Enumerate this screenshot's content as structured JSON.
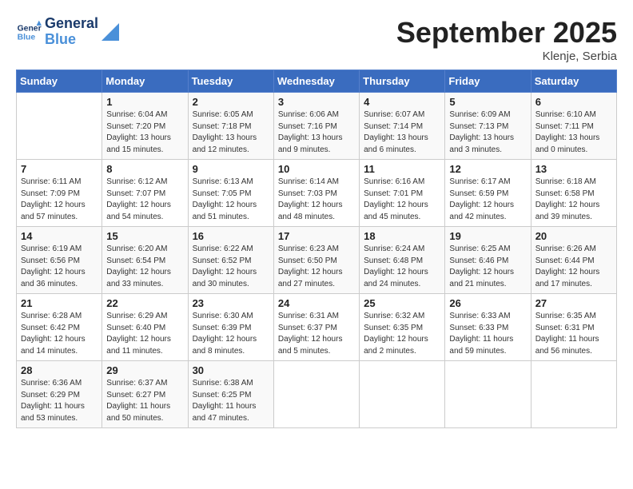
{
  "header": {
    "logo_general": "General",
    "logo_blue": "Blue",
    "month_title": "September 2025",
    "location": "Klenje, Serbia"
  },
  "weekdays": [
    "Sunday",
    "Monday",
    "Tuesday",
    "Wednesday",
    "Thursday",
    "Friday",
    "Saturday"
  ],
  "weeks": [
    [
      {
        "day": "",
        "info": ""
      },
      {
        "day": "1",
        "info": "Sunrise: 6:04 AM\nSunset: 7:20 PM\nDaylight: 13 hours\nand 15 minutes."
      },
      {
        "day": "2",
        "info": "Sunrise: 6:05 AM\nSunset: 7:18 PM\nDaylight: 13 hours\nand 12 minutes."
      },
      {
        "day": "3",
        "info": "Sunrise: 6:06 AM\nSunset: 7:16 PM\nDaylight: 13 hours\nand 9 minutes."
      },
      {
        "day": "4",
        "info": "Sunrise: 6:07 AM\nSunset: 7:14 PM\nDaylight: 13 hours\nand 6 minutes."
      },
      {
        "day": "5",
        "info": "Sunrise: 6:09 AM\nSunset: 7:13 PM\nDaylight: 13 hours\nand 3 minutes."
      },
      {
        "day": "6",
        "info": "Sunrise: 6:10 AM\nSunset: 7:11 PM\nDaylight: 13 hours\nand 0 minutes."
      }
    ],
    [
      {
        "day": "7",
        "info": "Sunrise: 6:11 AM\nSunset: 7:09 PM\nDaylight: 12 hours\nand 57 minutes."
      },
      {
        "day": "8",
        "info": "Sunrise: 6:12 AM\nSunset: 7:07 PM\nDaylight: 12 hours\nand 54 minutes."
      },
      {
        "day": "9",
        "info": "Sunrise: 6:13 AM\nSunset: 7:05 PM\nDaylight: 12 hours\nand 51 minutes."
      },
      {
        "day": "10",
        "info": "Sunrise: 6:14 AM\nSunset: 7:03 PM\nDaylight: 12 hours\nand 48 minutes."
      },
      {
        "day": "11",
        "info": "Sunrise: 6:16 AM\nSunset: 7:01 PM\nDaylight: 12 hours\nand 45 minutes."
      },
      {
        "day": "12",
        "info": "Sunrise: 6:17 AM\nSunset: 6:59 PM\nDaylight: 12 hours\nand 42 minutes."
      },
      {
        "day": "13",
        "info": "Sunrise: 6:18 AM\nSunset: 6:58 PM\nDaylight: 12 hours\nand 39 minutes."
      }
    ],
    [
      {
        "day": "14",
        "info": "Sunrise: 6:19 AM\nSunset: 6:56 PM\nDaylight: 12 hours\nand 36 minutes."
      },
      {
        "day": "15",
        "info": "Sunrise: 6:20 AM\nSunset: 6:54 PM\nDaylight: 12 hours\nand 33 minutes."
      },
      {
        "day": "16",
        "info": "Sunrise: 6:22 AM\nSunset: 6:52 PM\nDaylight: 12 hours\nand 30 minutes."
      },
      {
        "day": "17",
        "info": "Sunrise: 6:23 AM\nSunset: 6:50 PM\nDaylight: 12 hours\nand 27 minutes."
      },
      {
        "day": "18",
        "info": "Sunrise: 6:24 AM\nSunset: 6:48 PM\nDaylight: 12 hours\nand 24 minutes."
      },
      {
        "day": "19",
        "info": "Sunrise: 6:25 AM\nSunset: 6:46 PM\nDaylight: 12 hours\nand 21 minutes."
      },
      {
        "day": "20",
        "info": "Sunrise: 6:26 AM\nSunset: 6:44 PM\nDaylight: 12 hours\nand 17 minutes."
      }
    ],
    [
      {
        "day": "21",
        "info": "Sunrise: 6:28 AM\nSunset: 6:42 PM\nDaylight: 12 hours\nand 14 minutes."
      },
      {
        "day": "22",
        "info": "Sunrise: 6:29 AM\nSunset: 6:40 PM\nDaylight: 12 hours\nand 11 minutes."
      },
      {
        "day": "23",
        "info": "Sunrise: 6:30 AM\nSunset: 6:39 PM\nDaylight: 12 hours\nand 8 minutes."
      },
      {
        "day": "24",
        "info": "Sunrise: 6:31 AM\nSunset: 6:37 PM\nDaylight: 12 hours\nand 5 minutes."
      },
      {
        "day": "25",
        "info": "Sunrise: 6:32 AM\nSunset: 6:35 PM\nDaylight: 12 hours\nand 2 minutes."
      },
      {
        "day": "26",
        "info": "Sunrise: 6:33 AM\nSunset: 6:33 PM\nDaylight: 11 hours\nand 59 minutes."
      },
      {
        "day": "27",
        "info": "Sunrise: 6:35 AM\nSunset: 6:31 PM\nDaylight: 11 hours\nand 56 minutes."
      }
    ],
    [
      {
        "day": "28",
        "info": "Sunrise: 6:36 AM\nSunset: 6:29 PM\nDaylight: 11 hours\nand 53 minutes."
      },
      {
        "day": "29",
        "info": "Sunrise: 6:37 AM\nSunset: 6:27 PM\nDaylight: 11 hours\nand 50 minutes."
      },
      {
        "day": "30",
        "info": "Sunrise: 6:38 AM\nSunset: 6:25 PM\nDaylight: 11 hours\nand 47 minutes."
      },
      {
        "day": "",
        "info": ""
      },
      {
        "day": "",
        "info": ""
      },
      {
        "day": "",
        "info": ""
      },
      {
        "day": "",
        "info": ""
      }
    ]
  ]
}
